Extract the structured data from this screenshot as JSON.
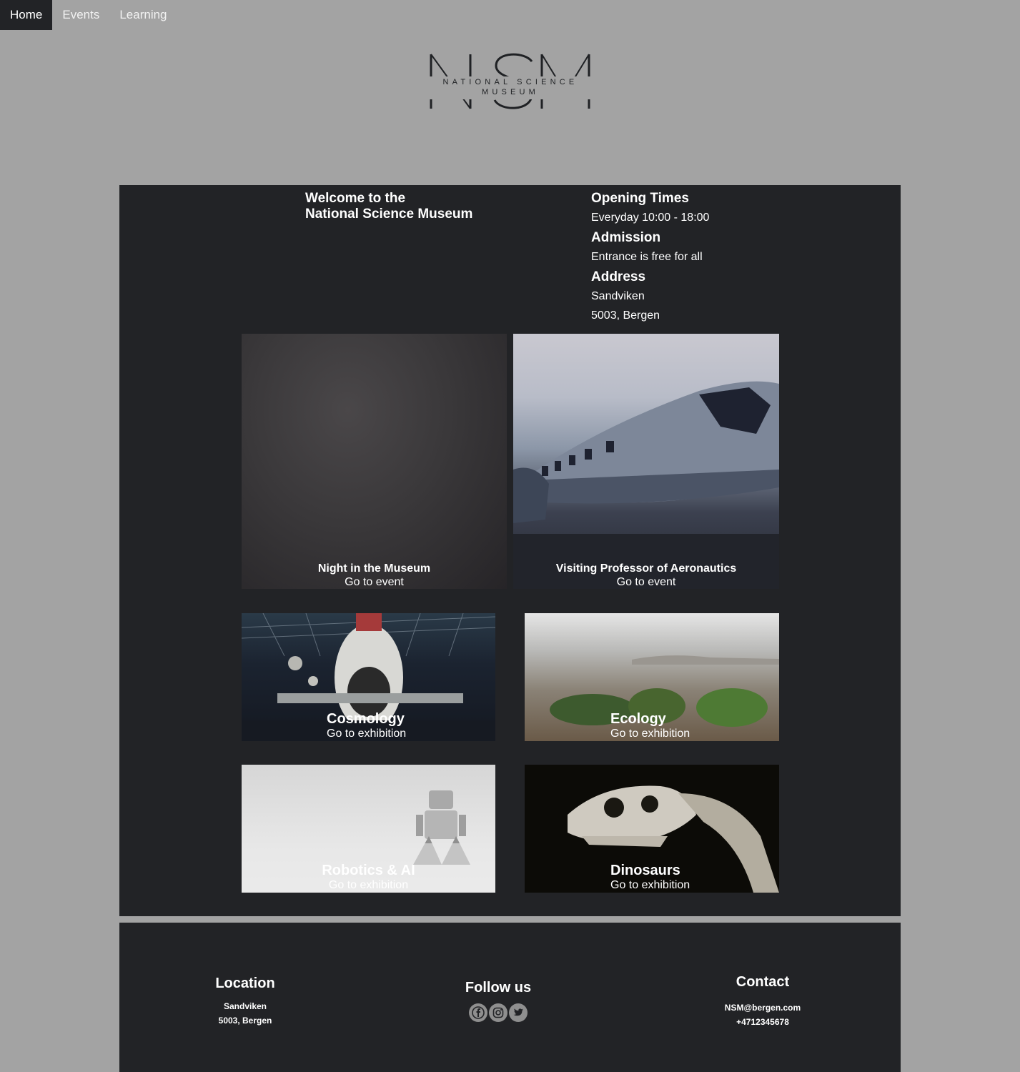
{
  "nav": {
    "items": [
      {
        "label": "Home",
        "active": true
      },
      {
        "label": "Events",
        "active": false
      },
      {
        "label": "Learning",
        "active": false
      }
    ]
  },
  "logo": {
    "letters": "NSM",
    "line1": "NATIONAL SCIENCE",
    "line2": "MUSEUM"
  },
  "welcome": {
    "line1": "Welcome to the",
    "line2": "National Science Museum"
  },
  "info": {
    "opening_title": "Opening Times",
    "opening_value": "Everyday 10:00 - 18:00",
    "admission_title": "Admission",
    "admission_value": "Entrance is free for all",
    "address_title": "Address",
    "address_line1": "Sandviken",
    "address_line2": "5003, Bergen"
  },
  "events": [
    {
      "title": "Night in the Museum",
      "link": "Go to event"
    },
    {
      "title": "Visiting Professor of Aeronautics",
      "link": "Go to event"
    }
  ],
  "exhibitions": [
    {
      "title": "Cosmology",
      "link": "Go to exhibition"
    },
    {
      "title": "Ecology",
      "link": "Go to exhibition"
    },
    {
      "title": "Robotics & AI",
      "link": "Go to exhibition"
    },
    {
      "title": "Dinosaurs",
      "link": "Go to exhibition"
    }
  ],
  "footer": {
    "location_title": "Location",
    "location_line1": "Sandviken",
    "location_line2": "5003, Bergen",
    "follow_title": "Follow us",
    "social_icons": [
      "facebook-icon",
      "instagram-icon",
      "twitter-icon"
    ],
    "contact_title": "Contact",
    "contact_email": "NSM@bergen.com",
    "contact_phone": "+4712345678"
  },
  "colors": {
    "page_bg": "#a3a3a3",
    "panel_bg": "#222326",
    "text": "#ffffff",
    "icon_bg": "#8f8f8f"
  }
}
